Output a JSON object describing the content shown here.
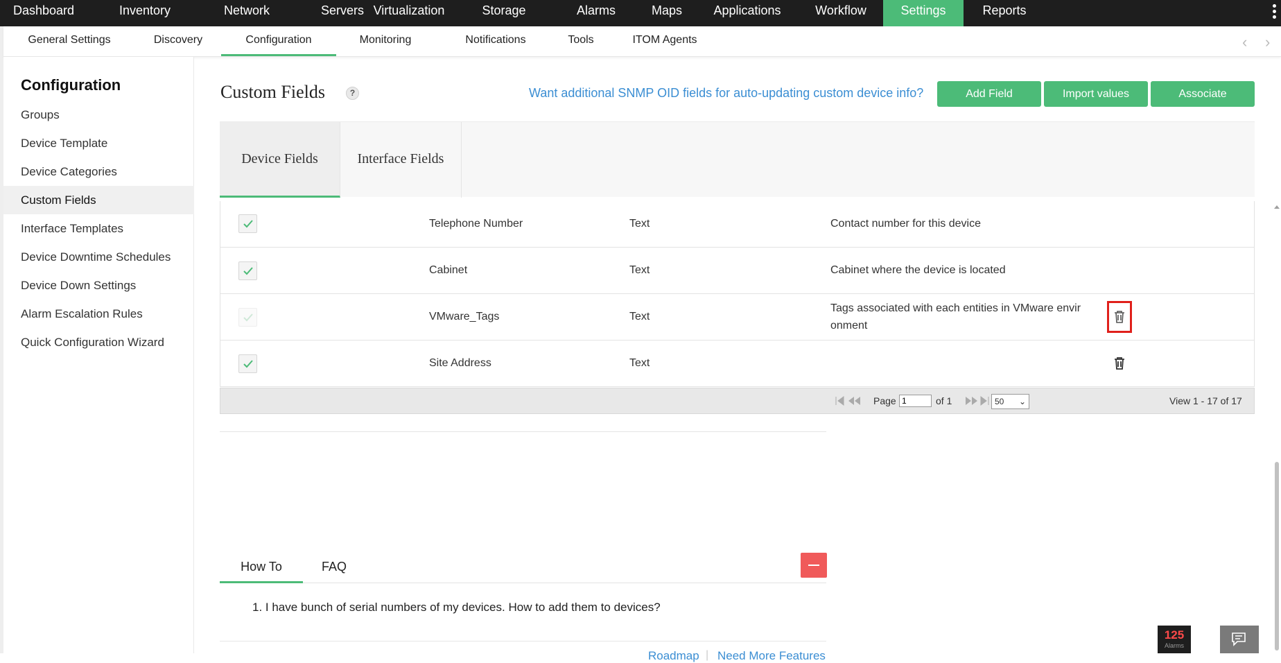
{
  "topnav": {
    "items": [
      "Dashboard",
      "Inventory",
      "Network",
      "Servers",
      "Virtualization",
      "Storage",
      "Alarms",
      "Maps",
      "Applications",
      "Workflow",
      "Settings",
      "Reports"
    ],
    "active": "Settings"
  },
  "subnav": {
    "items": [
      "General Settings",
      "Discovery",
      "Configuration",
      "Monitoring",
      "Notifications",
      "Tools",
      "ITOM Agents"
    ],
    "active": "Configuration"
  },
  "sidebar": {
    "title": "Configuration",
    "items": [
      "Groups",
      "Device Template",
      "Device Categories",
      "Custom Fields",
      "Interface Templates",
      "Device Downtime Schedules",
      "Device Down Settings",
      "Alarm Escalation Rules",
      "Quick Configuration Wizard"
    ],
    "active": "Custom Fields"
  },
  "page": {
    "title": "Custom Fields",
    "help": "?",
    "snmp_link": "Want additional SNMP OID fields for auto-updating custom device info?",
    "buttons": {
      "add": "Add Field",
      "import": "Import values",
      "associate": "Associate"
    }
  },
  "tabs": {
    "device": "Device Fields",
    "interface": "Interface Fields"
  },
  "rows": [
    {
      "name": "Telephone Number",
      "type": "Text",
      "description": "Contact number for this device",
      "deletable": false,
      "checked": true
    },
    {
      "name": "Cabinet",
      "type": "Text",
      "description": "Cabinet where the device is located",
      "deletable": false,
      "checked": true
    },
    {
      "name": "VMware_Tags",
      "type": "Text",
      "description_line1": "Tags associated with each entities in VMware envir",
      "description_line2": "onment",
      "deletable": true,
      "checked": true,
      "highlighted": true
    },
    {
      "name": "Site Address",
      "type": "Text",
      "description": "",
      "deletable": true,
      "checked": true
    }
  ],
  "pager": {
    "page_label": "Page",
    "page_value": "1",
    "of_label": "of 1",
    "page_size": "50",
    "view_text": "View 1 - 17 of 17"
  },
  "help_panel": {
    "tabs": {
      "howto": "How To",
      "faq": "FAQ"
    },
    "howto_items": [
      "1. I have bunch of serial numbers of my devices. How to add them to devices?"
    ]
  },
  "footer": {
    "roadmap": "Roadmap",
    "separator": "|",
    "features": "Need More Features"
  },
  "alarms": {
    "count": "125",
    "label": "Alarms"
  },
  "colors": {
    "accent": "#4cbb78",
    "link": "#3b8ed3",
    "topbar": "#1e1e1e",
    "danger": "#e0201b"
  }
}
